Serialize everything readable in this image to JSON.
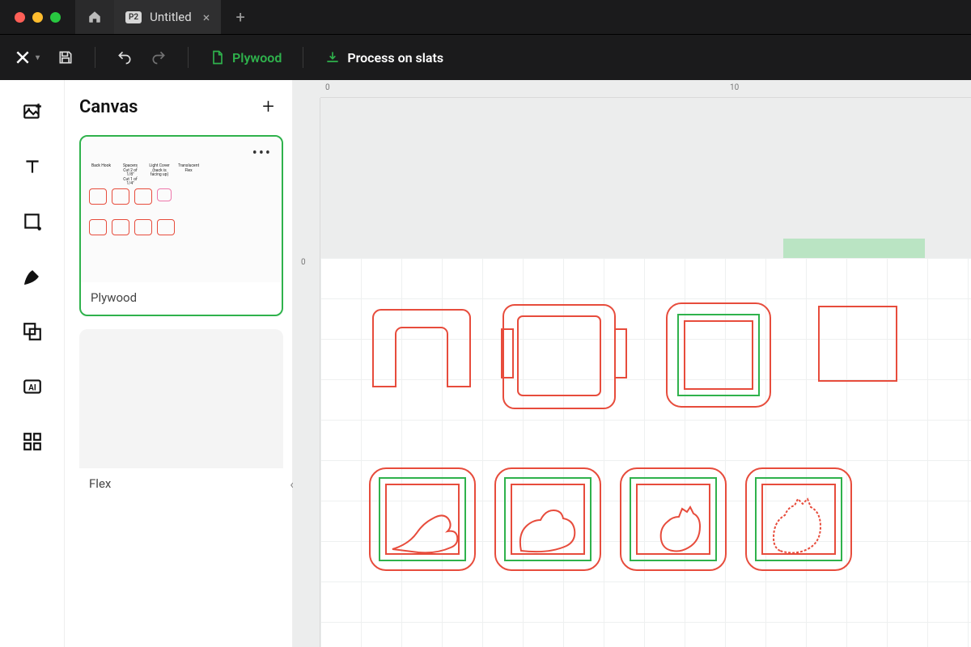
{
  "titlebar": {
    "doc_badge": "P2",
    "doc_name": "Untitled"
  },
  "toolbar": {
    "material_label": "Plywood",
    "process_label": "Process on slats"
  },
  "panel": {
    "title": "Canvas",
    "cards": [
      {
        "label": "Plywood",
        "selected": true
      },
      {
        "label": "Flex",
        "selected": false
      }
    ]
  },
  "ruler": {
    "h_ticks": [
      "0",
      "10"
    ],
    "v_ticks": [
      "0"
    ]
  },
  "canvas_objects": {
    "row1": [
      {
        "title_lines": [
          "Back Hook"
        ]
      },
      {
        "title_lines": [
          "Spacers",
          "Cut 2 of 1/8\"",
          "Cut 1 of 1/4\""
        ]
      },
      {
        "title_lines": [
          "Light Cover",
          "(back is facing up)"
        ]
      },
      {
        "title_lines": [
          "Translucent Flex"
        ],
        "selected": true
      }
    ]
  },
  "colors": {
    "accent_green": "#2fb24c",
    "cut_red": "#e74c3c"
  }
}
